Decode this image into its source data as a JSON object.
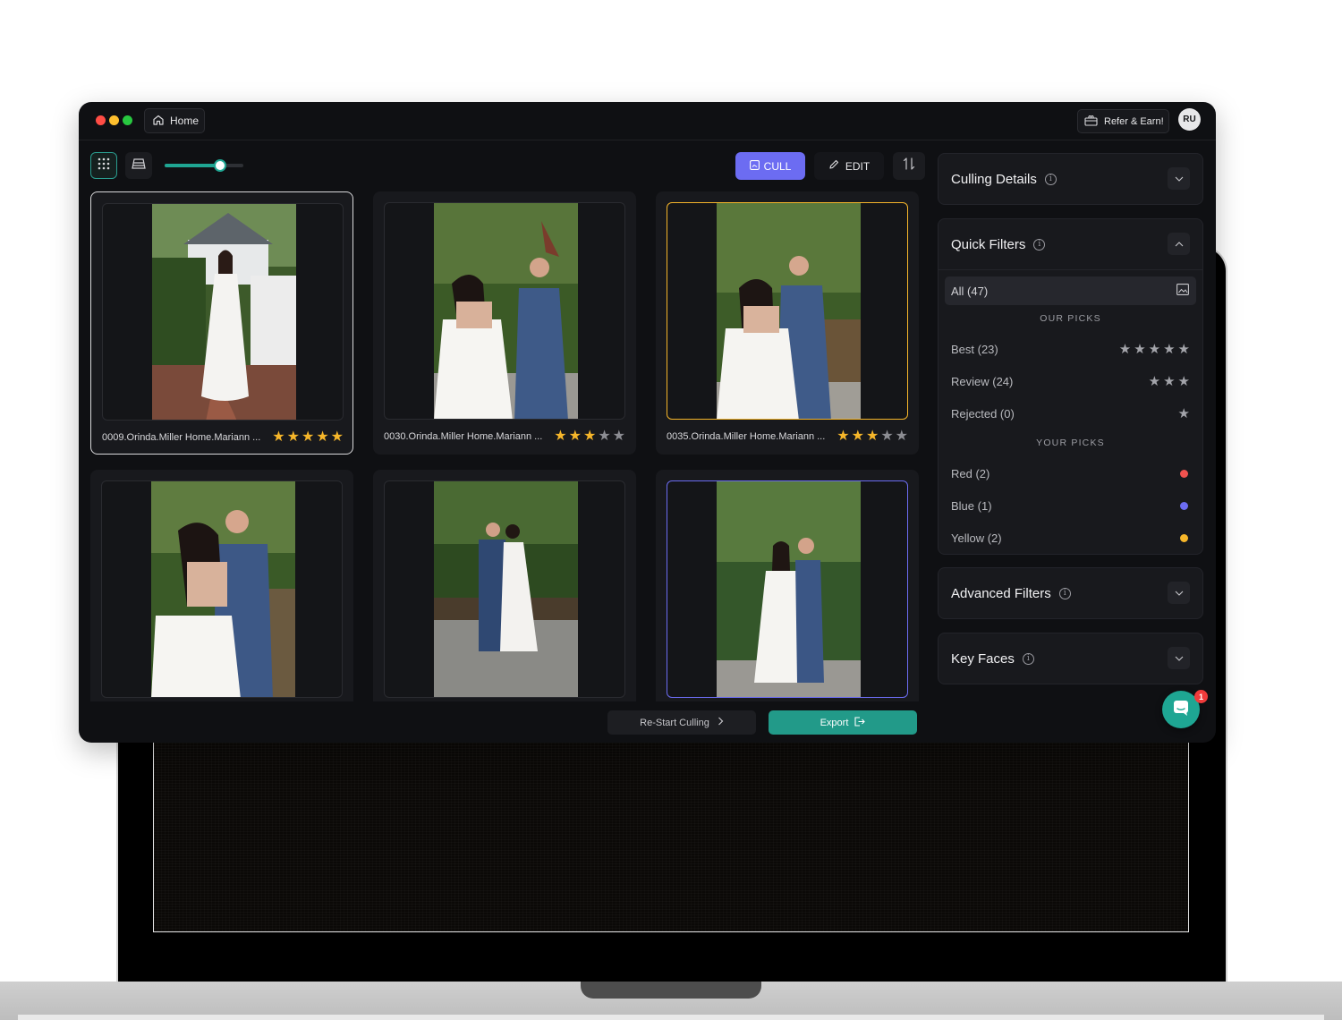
{
  "titlebar": {
    "home_label": "Home",
    "refer_label": "Refer & Earn!",
    "avatar_initials": "RU"
  },
  "toolbar": {
    "zoom_level": 0.7,
    "cull_label": "CULL",
    "edit_label": "EDIT"
  },
  "grid": {
    "cards": [
      {
        "filename": "0009.Orinda.Miller Home.Mariann ...",
        "rating": 5,
        "tag": "none",
        "selected": true
      },
      {
        "filename": "0030.Orinda.Miller Home.Mariann ...",
        "rating": 3,
        "tag": "none",
        "selected": false
      },
      {
        "filename": "0035.Orinda.Miller Home.Mariann ...",
        "rating": 3,
        "tag": "yellow",
        "selected": false
      },
      {
        "filename": "",
        "rating": 0,
        "tag": "none",
        "selected": false
      },
      {
        "filename": "",
        "rating": 0,
        "tag": "none",
        "selected": false
      },
      {
        "filename": "",
        "rating": 0,
        "tag": "blue",
        "selected": false
      }
    ]
  },
  "actions": {
    "restart_label": "Re-Start Culling",
    "export_label": "Export"
  },
  "panels": {
    "culling_details": {
      "title": "Culling Details"
    },
    "quick_filters": {
      "title": "Quick Filters",
      "all_label": "All (47)",
      "our_picks_heading": "OUR PICKS",
      "our_picks": [
        {
          "label": "Best (23)",
          "stars": 5
        },
        {
          "label": "Review (24)",
          "stars": 3
        },
        {
          "label": "Rejected (0)",
          "stars": 1
        }
      ],
      "your_picks_heading": "YOUR PICKS",
      "your_picks": [
        {
          "label": "Red (2)",
          "color": "#f0524f"
        },
        {
          "label": "Blue (1)",
          "color": "#6c6cf2"
        },
        {
          "label": "Yellow (2)",
          "color": "#f6b62a"
        }
      ]
    },
    "advanced_filters": {
      "title": "Advanced Filters"
    },
    "key_faces": {
      "title": "Key Faces"
    }
  },
  "chat": {
    "badge_count": "1"
  },
  "colors": {
    "accent_teal": "#229a89",
    "accent_purple": "#6c6cf2",
    "star_gold": "#f6b62a"
  }
}
